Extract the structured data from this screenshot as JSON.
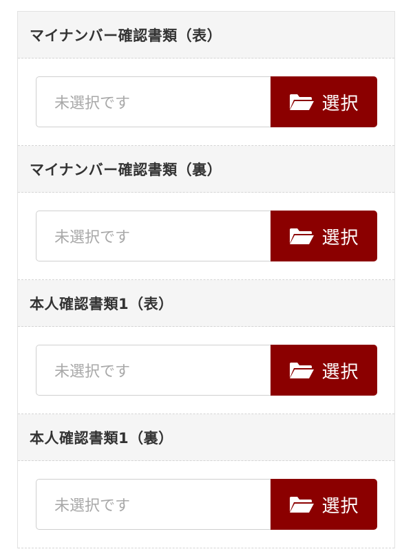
{
  "sections": [
    {
      "title": "マイナンバー確認書類（表）",
      "placeholder": "未選択です",
      "button_label": "選択",
      "icon": "folder-open-icon"
    },
    {
      "title": "マイナンバー確認書類（裏）",
      "placeholder": "未選択です",
      "button_label": "選択",
      "icon": "folder-open-icon"
    },
    {
      "title": "本人確認書類1（表）",
      "placeholder": "未選択です",
      "button_label": "選択",
      "icon": "folder-open-icon"
    },
    {
      "title": "本人確認書類1（裏）",
      "placeholder": "未選択です",
      "button_label": "選択",
      "icon": "folder-open-icon"
    }
  ],
  "colors": {
    "button_bg": "#8b0000",
    "header_bg": "#f5f5f5",
    "placeholder_text": "#a8a8a8"
  }
}
